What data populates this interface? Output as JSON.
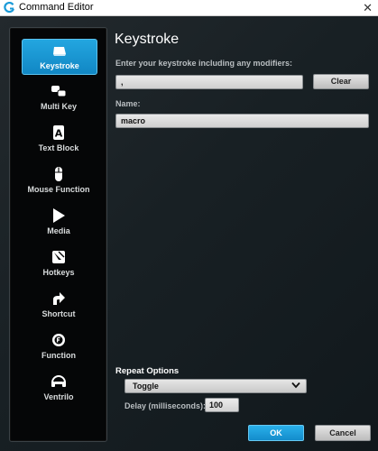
{
  "window": {
    "title": "Command Editor",
    "logo_icon": "logitech-g-icon",
    "close_glyph": "✕"
  },
  "sidebar": {
    "items": [
      {
        "label": "Keystroke",
        "icon": "keycap-icon",
        "active": true
      },
      {
        "label": "Multi Key",
        "icon": "multi-key-icon",
        "active": false
      },
      {
        "label": "Text Block",
        "icon": "text-block-icon",
        "active": false
      },
      {
        "label": "Mouse Function",
        "icon": "mouse-icon",
        "active": false
      },
      {
        "label": "Media",
        "icon": "play-icon",
        "active": false
      },
      {
        "label": "Hotkeys",
        "icon": "hotkey-icon",
        "active": false
      },
      {
        "label": "Shortcut",
        "icon": "shortcut-arrow-icon",
        "active": false
      },
      {
        "label": "Function",
        "icon": "function-gear-icon",
        "active": false
      },
      {
        "label": "Ventrilo",
        "icon": "headset-icon",
        "active": false
      }
    ],
    "text_block_glyph": "A"
  },
  "main": {
    "heading": "Keystroke",
    "keystroke_prompt": "Enter your keystroke including any modifiers:",
    "keystroke_value": ",",
    "clear_label": "Clear",
    "name_label": "Name:",
    "name_value": "macro"
  },
  "repeat": {
    "title": "Repeat Options",
    "mode_value": "Toggle",
    "delay_label": "Delay (milliseconds):",
    "delay_value": "100"
  },
  "footer": {
    "ok_label": "OK",
    "cancel_label": "Cancel"
  },
  "colors": {
    "accent": "#1a9ad8",
    "background": "#1b2023",
    "sidebar": "#050607"
  }
}
